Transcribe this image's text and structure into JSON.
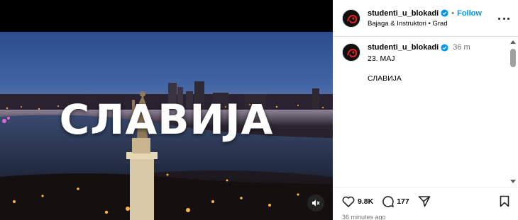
{
  "video": {
    "overlay_title": "СЛАВИЈА"
  },
  "header": {
    "username": "studenti_u_blokadi",
    "separator": "•",
    "follow_label": "Follow",
    "audio_line": "Bajaga & Instruktori • Grad"
  },
  "caption": {
    "username": "studenti_u_blokadi",
    "time": "36 m",
    "date_line": "23. МАЈ",
    "text": "СЛАВИЈА"
  },
  "actions": {
    "likes": "9.8K",
    "comments": "177",
    "posted": "36 minutes ago"
  },
  "colors": {
    "follow_blue": "#0095f6",
    "verified_blue": "#0095f6"
  },
  "icons": [
    "heart-icon",
    "comment-icon",
    "share-icon",
    "bookmark-icon",
    "more-icon",
    "verified-badge-icon",
    "mute-icon"
  ]
}
